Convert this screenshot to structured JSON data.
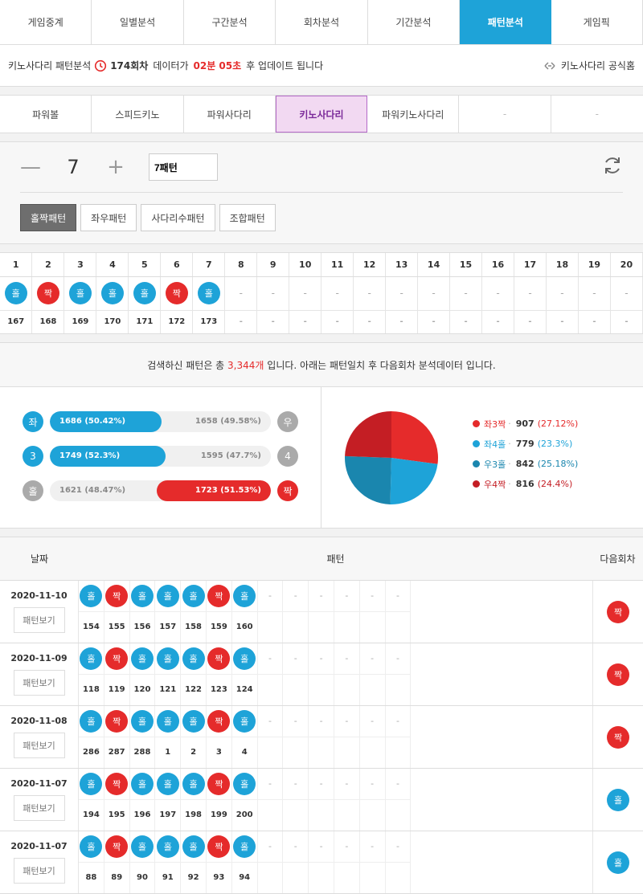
{
  "top_tabs": [
    {
      "label": "게임중계"
    },
    {
      "label": "일별분석"
    },
    {
      "label": "구간분석"
    },
    {
      "label": "회차분석"
    },
    {
      "label": "기간분석"
    },
    {
      "label": "패턴분석"
    },
    {
      "label": "게임픽"
    }
  ],
  "info": {
    "prefix": "키노사다리 패턴분석",
    "round": "174회차",
    "mid": "데이터가",
    "countdown": "02분 05초",
    "suffix": "후 업데이트 됩니다",
    "official": "키노사다리 공식홈"
  },
  "sub_tabs": [
    {
      "label": "파워볼"
    },
    {
      "label": "스피드키노"
    },
    {
      "label": "파워사다리"
    },
    {
      "label": "키노사다리"
    },
    {
      "label": "파워키노사다리"
    },
    {
      "label": "-"
    },
    {
      "label": "-"
    }
  ],
  "control": {
    "minus": "—",
    "count": "7",
    "plus": "+",
    "pattern_value": "7패턴",
    "buttons": [
      {
        "label": "홀짝패턴"
      },
      {
        "label": "좌우패턴"
      },
      {
        "label": "사다리수패턴"
      },
      {
        "label": "조합패턴"
      }
    ]
  },
  "grid": {
    "headers": [
      "1",
      "2",
      "3",
      "4",
      "5",
      "6",
      "7",
      "8",
      "9",
      "10",
      "11",
      "12",
      "13",
      "14",
      "15",
      "16",
      "17",
      "18",
      "19",
      "20"
    ],
    "balls": [
      {
        "t": "홀",
        "c": "blue"
      },
      {
        "t": "짝",
        "c": "red"
      },
      {
        "t": "홀",
        "c": "blue"
      },
      {
        "t": "홀",
        "c": "blue"
      },
      {
        "t": "홀",
        "c": "blue"
      },
      {
        "t": "짝",
        "c": "red"
      },
      {
        "t": "홀",
        "c": "blue"
      },
      {
        "t": "-",
        "c": ""
      },
      {
        "t": "-",
        "c": ""
      },
      {
        "t": "-",
        "c": ""
      },
      {
        "t": "-",
        "c": ""
      },
      {
        "t": "-",
        "c": ""
      },
      {
        "t": "-",
        "c": ""
      },
      {
        "t": "-",
        "c": ""
      },
      {
        "t": "-",
        "c": ""
      },
      {
        "t": "-",
        "c": ""
      },
      {
        "t": "-",
        "c": ""
      },
      {
        "t": "-",
        "c": ""
      },
      {
        "t": "-",
        "c": ""
      },
      {
        "t": "-",
        "c": ""
      }
    ],
    "rounds": [
      "167",
      "168",
      "169",
      "170",
      "171",
      "172",
      "173",
      "-",
      "-",
      "-",
      "-",
      "-",
      "-",
      "-",
      "-",
      "-",
      "-",
      "-",
      "-",
      "-"
    ]
  },
  "summary": {
    "pre": "검색하신 패턴은 총",
    "count": "3,344개",
    "post": "입니다. 아래는 패턴일치 후 다음회차 분석데이터 입니다.",
    "bars": [
      {
        "left_label": "좌",
        "right_label": "우",
        "left_text": "1686 (50.42%)",
        "right_text": "1658 (49.58%)",
        "left_pct": 50.42,
        "side": "left",
        "color": "blue"
      },
      {
        "left_label": "3",
        "right_label": "4",
        "left_text": "1749 (52.3%)",
        "right_text": "1595 (47.7%)",
        "left_pct": 52.3,
        "side": "left",
        "color": "blue"
      },
      {
        "left_label": "홀",
        "right_label": "짝",
        "left_text": "1621 (48.47%)",
        "right_text": "1723 (51.53%)",
        "left_pct": 48.47,
        "side": "right",
        "color": "red"
      }
    ],
    "legend": [
      {
        "name": "좌3짝",
        "value": "907",
        "pct": "(27.12%)",
        "color": "#e52b2b",
        "share": 27.12
      },
      {
        "name": "좌4홀",
        "value": "779",
        "pct": "(23.3%)",
        "color": "#1ea3d8",
        "share": 23.3
      },
      {
        "name": "우3홀",
        "value": "842",
        "pct": "(25.18%)",
        "color": "#1a86ae",
        "share": 25.18
      },
      {
        "name": "우4짝",
        "value": "816",
        "pct": "(24.4%)",
        "color": "#c41e24",
        "share": 24.4
      }
    ]
  },
  "history": {
    "col_date": "날짜",
    "col_pattern": "패턴",
    "col_next": "다음회차",
    "view_label": "패턴보기",
    "rows": [
      {
        "date": "2020-11-10",
        "balls": [
          "홀",
          "짝",
          "홀",
          "홀",
          "홀",
          "짝",
          "홀"
        ],
        "rounds": [
          "154",
          "155",
          "156",
          "157",
          "158",
          "159",
          "160"
        ],
        "next": "짝"
      },
      {
        "date": "2020-11-09",
        "balls": [
          "홀",
          "짝",
          "홀",
          "홀",
          "홀",
          "짝",
          "홀"
        ],
        "rounds": [
          "118",
          "119",
          "120",
          "121",
          "122",
          "123",
          "124"
        ],
        "next": "짝"
      },
      {
        "date": "2020-11-08",
        "balls": [
          "홀",
          "짝",
          "홀",
          "홀",
          "홀",
          "짝",
          "홀"
        ],
        "rounds": [
          "286",
          "287",
          "288",
          "1",
          "2",
          "3",
          "4"
        ],
        "next": "짝"
      },
      {
        "date": "2020-11-07",
        "balls": [
          "홀",
          "짝",
          "홀",
          "홀",
          "홀",
          "짝",
          "홀"
        ],
        "rounds": [
          "194",
          "195",
          "196",
          "197",
          "198",
          "199",
          "200"
        ],
        "next": "홀"
      },
      {
        "date": "2020-11-07",
        "balls": [
          "홀",
          "짝",
          "홀",
          "홀",
          "홀",
          "짝",
          "홀"
        ],
        "rounds": [
          "88",
          "89",
          "90",
          "91",
          "92",
          "93",
          "94"
        ],
        "next": "홀"
      }
    ]
  }
}
